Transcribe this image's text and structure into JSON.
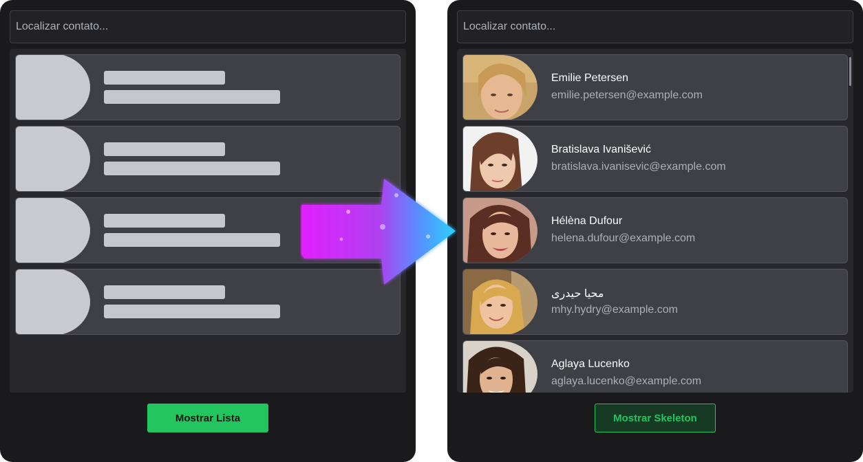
{
  "left_panel": {
    "search": {
      "placeholder": "Localizar contato..."
    },
    "skeleton_count": 4,
    "button_label": "Mostrar Lista"
  },
  "right_panel": {
    "search": {
      "placeholder": "Localizar contato..."
    },
    "contacts": [
      {
        "name": "Emilie Petersen",
        "email": "emilie.petersen@example.com"
      },
      {
        "name": "Bratislava Ivanišević",
        "email": "bratislava.ivanisevic@example.com"
      },
      {
        "name": "Hélèna Dufour",
        "email": "helena.dufour@example.com"
      },
      {
        "name": "محیا حیدری",
        "email": "mhy.hydry@example.com"
      },
      {
        "name": "Aglaya Lucenko",
        "email": "aglaya.lucenko@example.com"
      }
    ],
    "button_label": "Mostrar Skeleton"
  },
  "colors": {
    "panel_bg": "#1a1a1d",
    "card_bg": "#3f3f46",
    "skeleton": "#c9cacf",
    "accent": "#22c55e"
  },
  "icons": {
    "transition_arrow": "arrow-right-icon"
  }
}
